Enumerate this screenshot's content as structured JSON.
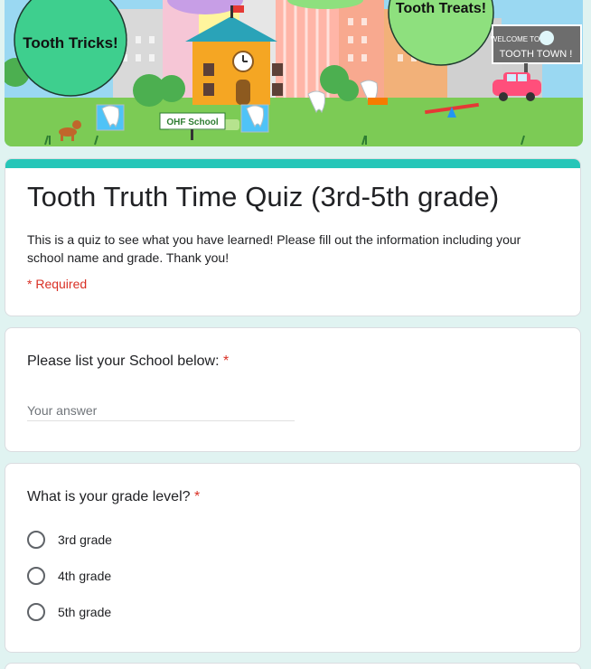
{
  "banner": {
    "bubble_left": "Tooth Tricks!",
    "bubble_right": "Tooth Treats!",
    "sign_line1": "WELCOME TO",
    "sign_line2": "TOOTH TOWN !",
    "school_sign": "OHF School"
  },
  "form": {
    "title": "Tooth Truth Time Quiz (3rd-5th grade)",
    "description": "This is a quiz to see what you have learned! Please fill out the information including your school name and grade. Thank you!",
    "required_note": "* Required"
  },
  "questions": [
    {
      "title": "Please list your School below:",
      "required_mark": "*",
      "placeholder": "Your answer"
    },
    {
      "title": "What is your grade level?",
      "required_mark": "*",
      "options": [
        "3rd grade",
        "4th grade",
        "5th grade"
      ]
    }
  ],
  "colors": {
    "accent": "#26c6b8",
    "required": "#d93025",
    "background": "#e0f3f1"
  }
}
